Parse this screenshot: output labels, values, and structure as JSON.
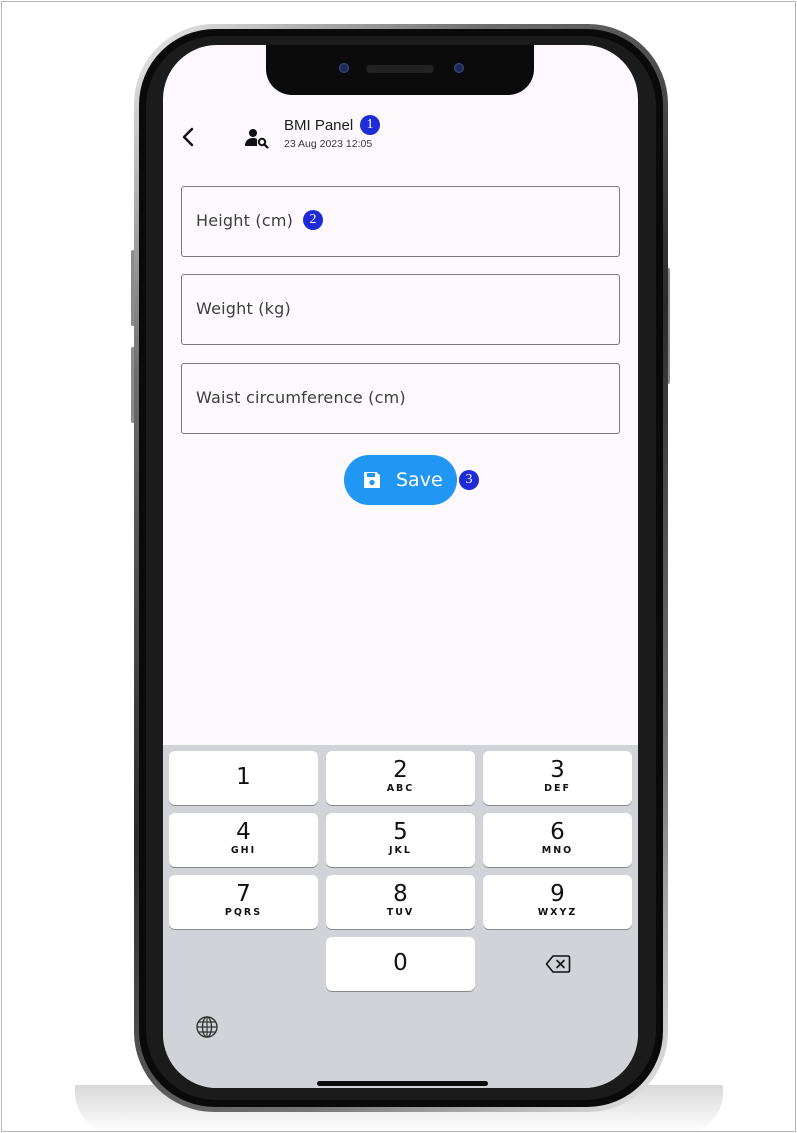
{
  "header": {
    "title": "BMI Panel",
    "timestamp": "23 Aug 2023 12:05",
    "title_badge": "1"
  },
  "form": {
    "fields": [
      {
        "label": "Height (cm)",
        "badge": "2"
      },
      {
        "label": "Weight (kg)"
      },
      {
        "label": "Waist circumference (cm)"
      }
    ]
  },
  "save_button": {
    "label": "Save",
    "badge": "3"
  },
  "keypad": {
    "keys": [
      {
        "num": "1",
        "letters": ""
      },
      {
        "num": "2",
        "letters": "ABC"
      },
      {
        "num": "3",
        "letters": "DEF"
      },
      {
        "num": "4",
        "letters": "GHI"
      },
      {
        "num": "5",
        "letters": "JKL"
      },
      {
        "num": "6",
        "letters": "MNO"
      },
      {
        "num": "7",
        "letters": "PQRS"
      },
      {
        "num": "8",
        "letters": "TUV"
      },
      {
        "num": "9",
        "letters": "WXYZ"
      },
      {
        "num": "0",
        "letters": ""
      }
    ]
  },
  "icons": {
    "back": "chevron-left-icon",
    "profile": "person-search-icon",
    "save": "floppy-disk-icon",
    "backspace": "backspace-icon",
    "globe": "globe-icon"
  },
  "colors": {
    "accent": "#2196f3",
    "badge": "#1f2bd6",
    "screen_bg": "#fcf8fc",
    "keyboard_bg": "#d1d3d9"
  }
}
